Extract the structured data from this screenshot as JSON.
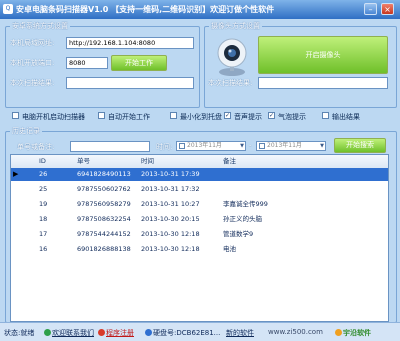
{
  "window": {
    "title": "安卓电脑条码扫描器V1.0 【支持一维码,二维码识别】欢迎订做个性软件",
    "app_icon": "Q",
    "minimize": "–",
    "close": "×"
  },
  "system": {
    "title": "安卓系统方式设置",
    "address_label": "本机局域网址:",
    "address_value": "http://192.168.1.104:8080",
    "port_label": "本机开放端口:",
    "port_value": "8080",
    "start_button": "开始工作",
    "result_label": "本次扫描结果:",
    "result_value": ""
  },
  "camera": {
    "title": "摄像头方式设置",
    "icon": "webcam-icon",
    "open_button": "开启摄像头",
    "result_label": "本次扫描结果:",
    "result_value": ""
  },
  "options": [
    {
      "label": "电脑开机启动扫描器",
      "checked": false
    },
    {
      "label": "自动开始工作",
      "checked": false
    },
    {
      "label": "最小化到托盘",
      "checked": false
    },
    {
      "label": "音声提示",
      "checked": true
    },
    {
      "label": "气泡提示",
      "checked": true
    },
    {
      "label": "输出结果",
      "checked": false
    }
  ],
  "history": {
    "title": "历史记录",
    "search_label": "单号或备注:",
    "search_value": "",
    "time_label": "时间:",
    "date_from": "2013年11月",
    "date_sep": "-",
    "date_to": "2013年11月",
    "search_button": "开始搜索",
    "columns": [
      "ID",
      "单号",
      "时间",
      "备注"
    ],
    "rows": [
      {
        "id": "26",
        "code": "6941828490113",
        "time": "2013-10-31 17:39",
        "note": "",
        "selected": true
      },
      {
        "id": "25",
        "code": "9787550602762",
        "time": "2013-10-31 17:32",
        "note": "",
        "selected": false
      },
      {
        "id": "19",
        "code": "9787560958279",
        "time": "2013-10-31 10:27",
        "note": "李嘉诚全传999",
        "selected": false
      },
      {
        "id": "18",
        "code": "9787508632254",
        "time": "2013-10-30 20:15",
        "note": "孙正义的头脑",
        "selected": false
      },
      {
        "id": "17",
        "code": "9787544244152",
        "time": "2013-10-30 12:18",
        "note": "管道数学9",
        "selected": false
      },
      {
        "id": "16",
        "code": "6901826888138",
        "time": "2013-10-30 12:18",
        "note": "电池",
        "selected": false
      }
    ]
  },
  "status": {
    "state": "状态:就绪",
    "contact": "欢迎联系我们",
    "register": "程序注册",
    "hardware": "硬盘号:DCB62E81...",
    "more": "新的软件",
    "site": "www.zi500.com",
    "vendor": "宇沿软件"
  },
  "colors": {
    "title_bar": "#2f6fc4",
    "background": "#bcd8f2",
    "green_button": "#6fc02a",
    "selected_row": "#2f6fd0"
  }
}
